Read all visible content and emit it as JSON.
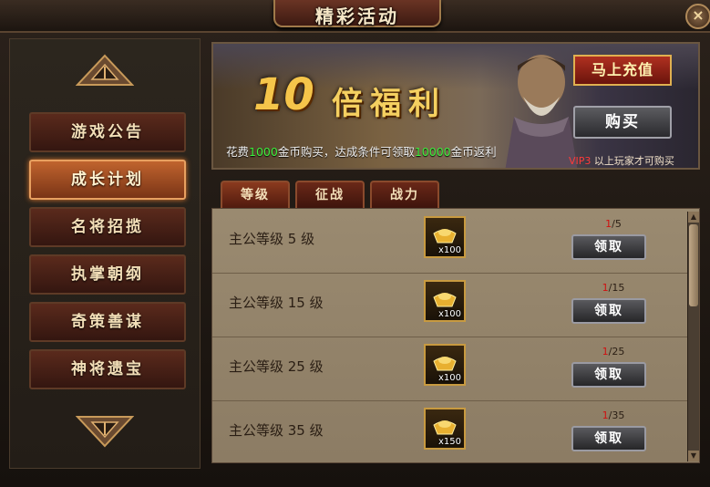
{
  "window": {
    "title": "精彩活动",
    "close_label": "×"
  },
  "sidebar": {
    "items": [
      {
        "label": "游戏公告",
        "active": false
      },
      {
        "label": "成长计划",
        "active": true
      },
      {
        "label": "名将招揽",
        "active": false
      },
      {
        "label": "执掌朝纲",
        "active": false
      },
      {
        "label": "奇策善谋",
        "active": false
      },
      {
        "label": "神将遗宝",
        "active": false
      }
    ]
  },
  "banner": {
    "big_number": "10",
    "title": "倍福利",
    "recharge_label": "马上充值",
    "buy_label": "购买",
    "promo_prefix": "花费",
    "promo_cost": "1000",
    "promo_middle": "金币购买，达成条件可领取",
    "promo_reward": "10000",
    "promo_suffix": "金币返利",
    "vip_level": "VIP3",
    "vip_note": " 以上玩家才可购买"
  },
  "tabs": [
    {
      "label": "等级",
      "active": true
    },
    {
      "label": "征战",
      "active": false
    },
    {
      "label": "战力",
      "active": false
    }
  ],
  "rows": [
    {
      "label": "主公等级 5  级",
      "qty": "x100",
      "progress_current": "1",
      "progress_total": "/5",
      "claim_label": "领取"
    },
    {
      "label": "主公等级 15 级",
      "qty": "x100",
      "progress_current": "1",
      "progress_total": "/15",
      "claim_label": "领取"
    },
    {
      "label": "主公等级 25 级",
      "qty": "x100",
      "progress_current": "1",
      "progress_total": "/25",
      "claim_label": "领取"
    },
    {
      "label": "主公等级 35 级",
      "qty": "x150",
      "progress_current": "1",
      "progress_total": "/35",
      "claim_label": "领取"
    }
  ],
  "colors": {
    "accent_gold": "#f5c54a",
    "highlight_green": "#3ef03e",
    "vip_red": "#ff3a3a",
    "progress_red": "#d01010"
  }
}
